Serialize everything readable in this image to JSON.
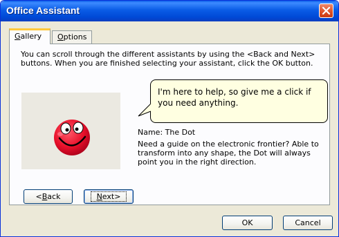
{
  "window": {
    "title": "Office Assistant"
  },
  "tabs": {
    "gallery": {
      "accel": "G",
      "rest": "allery"
    },
    "options": {
      "accel": "O",
      "rest": "ptions"
    }
  },
  "gallery": {
    "intro": "You can scroll through the different assistants by using the <Back and Next> buttons. When you are finished selecting your assistant, click the OK button.",
    "bubble_text": "I'm here to help, so give me a click if you need anything.",
    "name_line": "Name:  The Dot",
    "description": "Need a guide on the electronic frontier? Able to transform into any shape, the Dot will always point you in the right direction.",
    "back_button": {
      "pre": "<",
      "accel": "B",
      "post": "ack"
    },
    "next_button": {
      "accel": "N",
      "post": "ext>"
    }
  },
  "footer": {
    "ok_label": "OK",
    "cancel_label": "Cancel"
  },
  "icons": {
    "close": "close-icon",
    "assistant": "the-dot-assistant-icon"
  },
  "colors": {
    "titlebar": "#0a5ce6",
    "close": "#e0532a",
    "dialog_bg": "#ece9d8",
    "bubble_bg": "#ffffe1",
    "dot_red": "#e8102a"
  }
}
